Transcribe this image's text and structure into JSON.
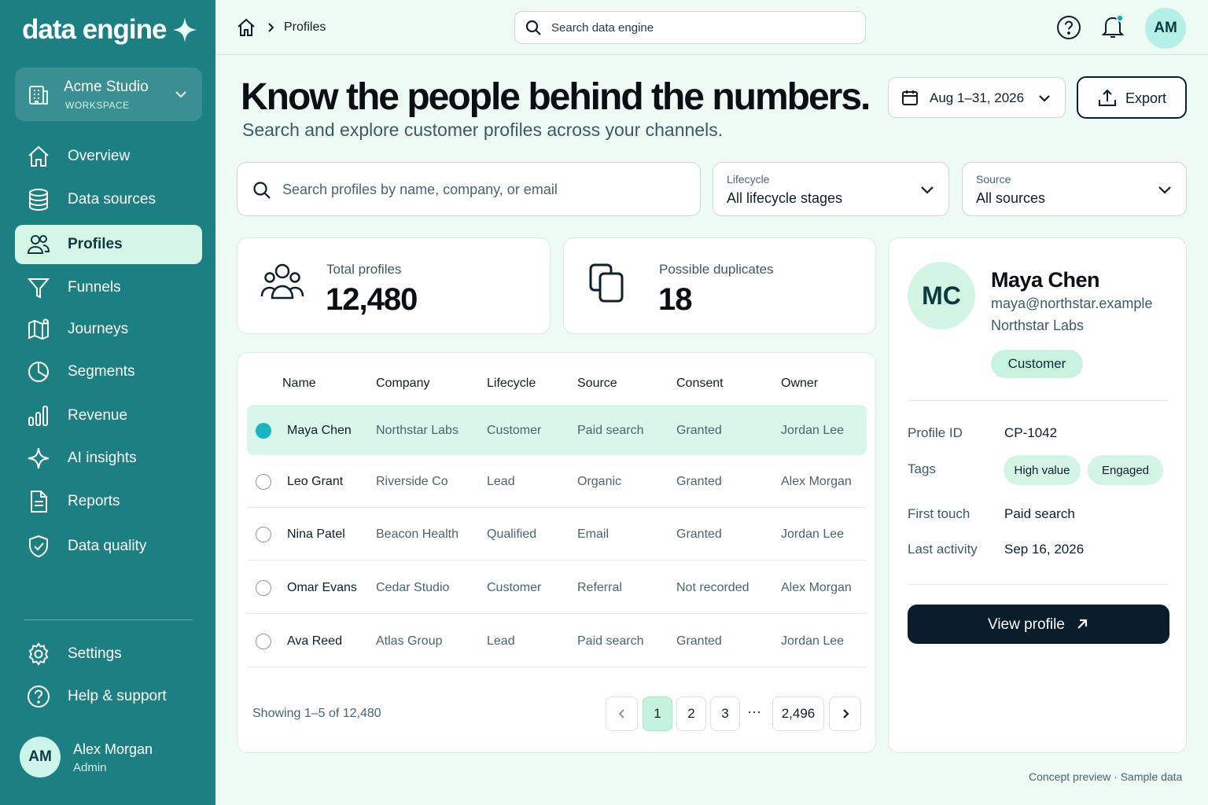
{
  "brand": {
    "name": "data engine"
  },
  "workspace": {
    "name": "Acme Studio",
    "label": "WORKSPACE"
  },
  "nav": [
    {
      "label": "Overview",
      "icon": "home-icon"
    },
    {
      "label": "Data sources",
      "icon": "database-icon"
    },
    {
      "label": "Profiles",
      "icon": "users-icon",
      "active": true
    },
    {
      "label": "Funnels",
      "icon": "funnel-icon"
    },
    {
      "label": "Journeys",
      "icon": "map-icon"
    },
    {
      "label": "Segments",
      "icon": "pie-chart-icon"
    },
    {
      "label": "Revenue",
      "icon": "bar-chart-icon"
    },
    {
      "label": "AI insights",
      "icon": "sparkle-icon"
    },
    {
      "label": "Reports",
      "icon": "document-icon"
    },
    {
      "label": "Data quality",
      "icon": "shield-check-icon"
    }
  ],
  "nav_bottom": [
    {
      "label": "Settings",
      "icon": "gear-icon"
    },
    {
      "label": "Help & support",
      "icon": "help-icon"
    }
  ],
  "current_user": {
    "initials": "AM",
    "name": "Alex Morgan",
    "role": "Admin"
  },
  "topbar": {
    "breadcrumb": "Profiles",
    "search_placeholder": "Search data engine",
    "avatar_initials": "AM"
  },
  "header": {
    "title": "Know the people behind the numbers.",
    "subtitle": "Search and explore customer profiles across your channels.",
    "date_range": "Aug 1–31, 2026",
    "export_label": "Export"
  },
  "filters": {
    "search_placeholder": "Search profiles by name, company, or email",
    "lifecycle": {
      "label": "Lifecycle",
      "value": "All lifecycle stages"
    },
    "source": {
      "label": "Source",
      "value": "All sources"
    }
  },
  "stats": {
    "total": {
      "label": "Total profiles",
      "value": "12,480"
    },
    "duplicates": {
      "label": "Possible duplicates",
      "value": "18"
    }
  },
  "table": {
    "columns": [
      "Name",
      "Company",
      "Lifecycle",
      "Source",
      "Consent",
      "Owner"
    ],
    "rows": [
      {
        "name": "Maya Chen",
        "company": "Northstar Labs",
        "lifecycle": "Customer",
        "source": "Paid search",
        "consent": "Granted",
        "owner": "Jordan Lee",
        "selected": true
      },
      {
        "name": "Leo Grant",
        "company": "Riverside Co",
        "lifecycle": "Lead",
        "source": "Organic",
        "consent": "Granted",
        "owner": "Alex Morgan"
      },
      {
        "name": "Nina Patel",
        "company": "Beacon Health",
        "lifecycle": "Qualified",
        "source": "Email",
        "consent": "Granted",
        "owner": "Jordan Lee"
      },
      {
        "name": "Omar Evans",
        "company": "Cedar Studio",
        "lifecycle": "Customer",
        "source": "Referral",
        "consent": "Not recorded",
        "owner": "Alex Morgan"
      },
      {
        "name": "Ava Reed",
        "company": "Atlas Group",
        "lifecycle": "Lead",
        "source": "Paid search",
        "consent": "Granted",
        "owner": "Jordan Lee"
      }
    ],
    "showing": "Showing 1–5 of 12,480",
    "pages": [
      "1",
      "2",
      "3"
    ],
    "ellipsis": "···",
    "last_page": "2,496",
    "current_page": "1"
  },
  "detail": {
    "initials": "MC",
    "name": "Maya Chen",
    "email": "maya@northstar.example",
    "company": "Northstar Labs",
    "badge": "Customer",
    "fields": {
      "profile_id_label": "Profile ID",
      "profile_id": "CP-1042",
      "tags_label": "Tags",
      "tags": [
        "High value",
        "Engaged"
      ],
      "first_touch_label": "First touch",
      "first_touch": "Paid search",
      "last_activity_label": "Last activity",
      "last_activity": "Sep 16, 2026"
    },
    "view_label": "View profile"
  },
  "footer_note": "Concept preview · Sample data"
}
